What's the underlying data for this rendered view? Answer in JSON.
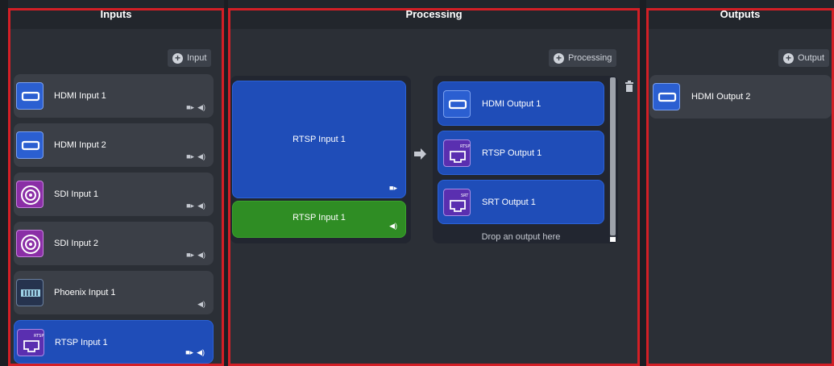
{
  "columns": {
    "inputs": {
      "title": "Inputs",
      "add_label": "Input"
    },
    "processing": {
      "title": "Processing",
      "add_label": "Processing"
    },
    "outputs": {
      "title": "Outputs",
      "add_label": "Output"
    }
  },
  "inputs": [
    {
      "label": "HDMI Input 1",
      "icon": "hdmi-icon"
    },
    {
      "label": "HDMI Input 2",
      "icon": "hdmi-icon"
    },
    {
      "label": "SDI Input 1",
      "icon": "sdi-icon"
    },
    {
      "label": "SDI Input 2",
      "icon": "sdi-icon"
    },
    {
      "label": "Phoenix Input 1",
      "icon": "phoenix-icon"
    },
    {
      "label": "RTSP Input 1",
      "icon": "rtsp-icon"
    }
  ],
  "processing": {
    "video_source": "RTSP Input 1",
    "audio_source": "RTSP Input 1",
    "outputs": [
      {
        "label": "HDMI Output 1",
        "icon": "hdmi-icon"
      },
      {
        "label": "RTSP Output 1",
        "icon": "rtsp-icon"
      },
      {
        "label": "SRT Output 1",
        "icon": "srt-icon"
      }
    ],
    "drop_hint": "Drop an output here"
  },
  "outputs": [
    {
      "label": "HDMI Output 2",
      "icon": "hdmi-icon"
    }
  ],
  "icon_tags": {
    "rtsp": "RTSP",
    "srt": "SRT"
  },
  "colors": {
    "highlight_border": "#d31f26",
    "video_card": "#1f4db8",
    "audio_card": "#2f8d24"
  }
}
